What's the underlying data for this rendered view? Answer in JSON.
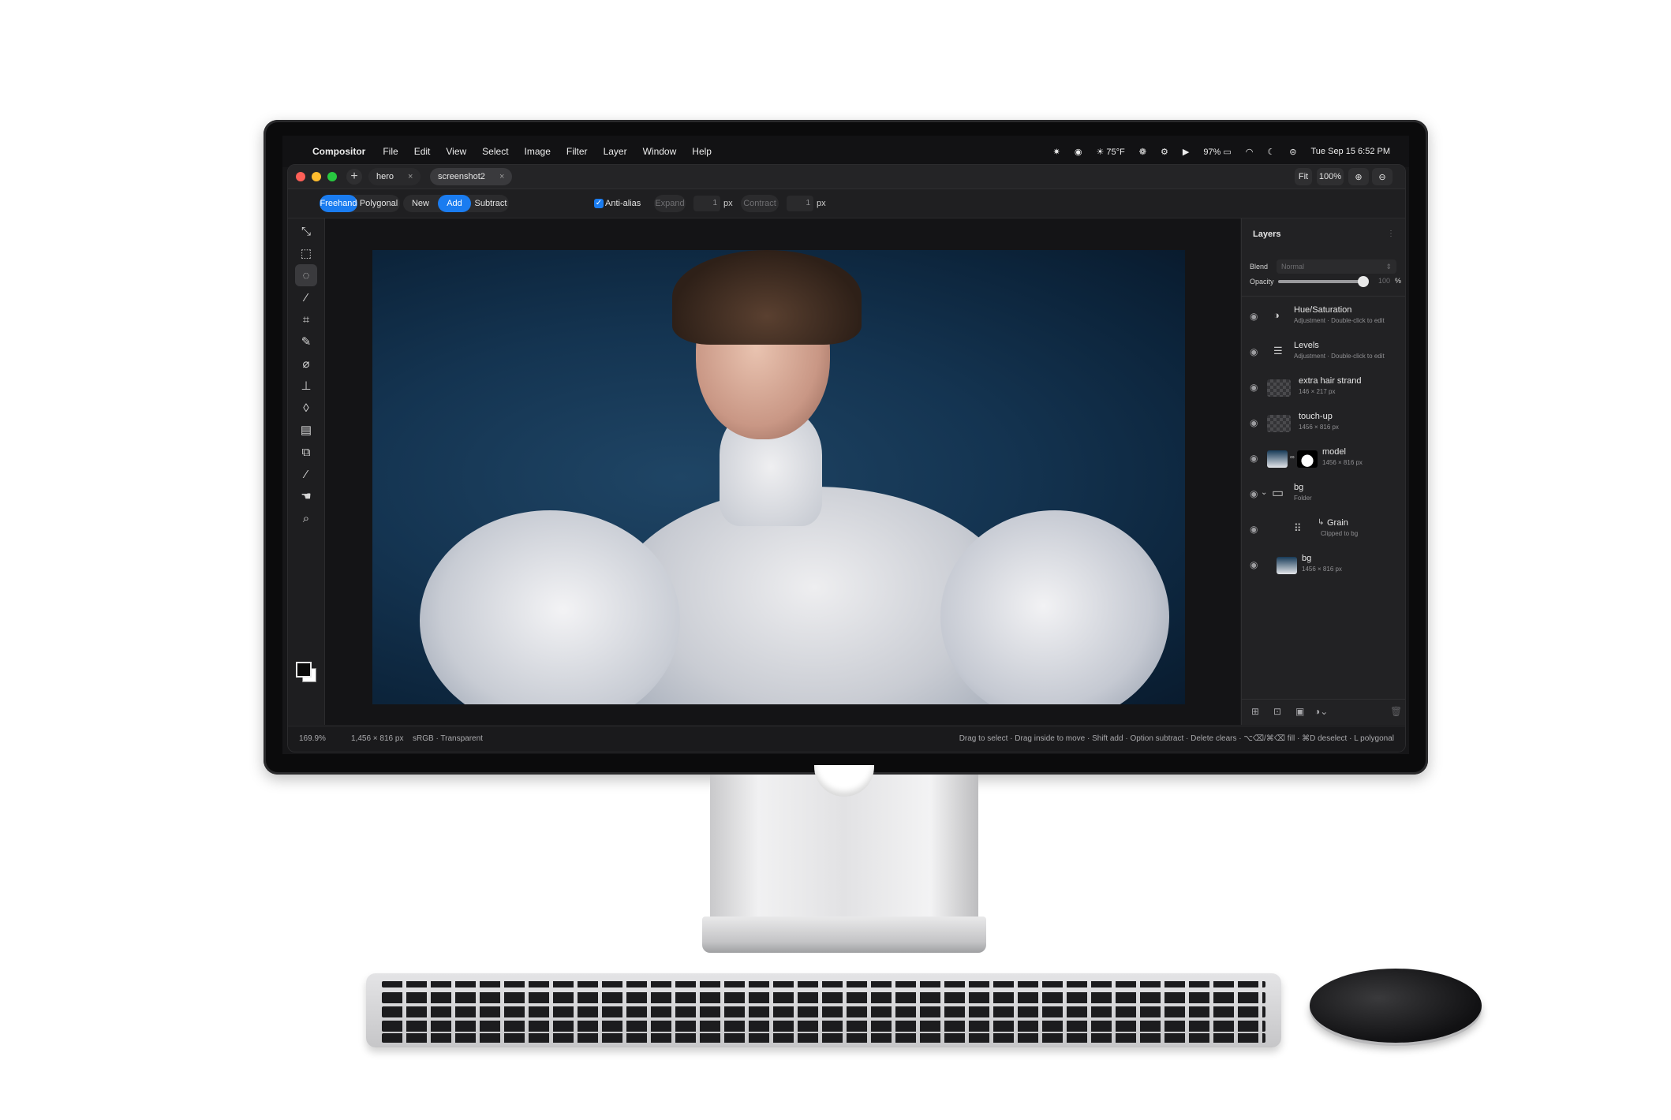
{
  "menubar": {
    "app_name": "Compositor",
    "menus": [
      "File",
      "Edit",
      "View",
      "Select",
      "Image",
      "Filter",
      "Layer",
      "Window",
      "Help"
    ],
    "weather": "75°F",
    "battery": "97%",
    "datetime": "Tue Sep 15  6:52 PM"
  },
  "tabs": [
    {
      "label": "hero"
    },
    {
      "label": "screenshot2"
    }
  ],
  "view": {
    "fit_label": "Fit",
    "zoom_value": "100%"
  },
  "options": {
    "mode_freehand": "Freehand",
    "mode_polygonal": "Polygonal",
    "sel_new": "New",
    "sel_add": "Add",
    "sel_subtract": "Subtract",
    "anti_alias": "Anti-alias",
    "expand_label": "Expand",
    "expand_value": "1",
    "expand_unit": "px",
    "contract_label": "Contract",
    "contract_value": "1",
    "contract_unit": "px"
  },
  "tools": [
    {
      "icon": "move-icon"
    },
    {
      "icon": "marquee-icon"
    },
    {
      "icon": "lasso-icon"
    },
    {
      "icon": "magic-wand-icon"
    },
    {
      "icon": "crop-icon"
    },
    {
      "icon": "brush-icon"
    },
    {
      "icon": "bandage-icon"
    },
    {
      "icon": "stamp-icon"
    },
    {
      "icon": "drop-icon"
    },
    {
      "icon": "gradient-icon"
    },
    {
      "icon": "shape-icon"
    },
    {
      "icon": "eyedropper-icon"
    },
    {
      "icon": "hand-icon"
    },
    {
      "icon": "zoom-icon"
    }
  ],
  "layers": {
    "title": "Layers",
    "blend_label": "Blend",
    "blend_value": "Normal",
    "opacity_label": "Opacity",
    "opacity_value": "100",
    "opacity_unit": "%",
    "opacity_level": 1.0,
    "items": [
      {
        "name": "Hue/Saturation",
        "sub": "Adjustment · Double-click to edit",
        "icon": "half-circle-icon"
      },
      {
        "name": "Levels",
        "sub": "Adjustment · Double-click to edit",
        "icon": "sliders-icon"
      },
      {
        "name": "extra hair strand",
        "sub": "146 × 217 px",
        "icon": "transparent-thumb"
      },
      {
        "name": "touch-up",
        "sub": "1456 × 816 px",
        "icon": "transparent-thumb"
      },
      {
        "name": "model",
        "sub": "1456 × 816 px",
        "icon": "photo-thumb"
      },
      {
        "name": "bg",
        "sub": "Folder",
        "icon": "folder-icon"
      },
      {
        "name": "Grain",
        "sub": "Clipped to bg",
        "icon": "grid-icon"
      },
      {
        "name": "bg",
        "sub": "1456 × 816 px",
        "icon": "photo-thumb"
      }
    ]
  },
  "status": {
    "zoom": "169.9%",
    "dimensions": "1,456 × 816 px",
    "color_mode": "sRGB · Transparent",
    "hint": "Drag to select · Drag inside to move · Shift add · Option subtract · Delete clears · ⌥⌫/⌘⌫ fill · ⌘D deselect · L polygonal"
  },
  "colors": {
    "accent": "#1a7cf0",
    "window_bg": "#1b1b1d",
    "canvas_bg": "#0c243b"
  }
}
